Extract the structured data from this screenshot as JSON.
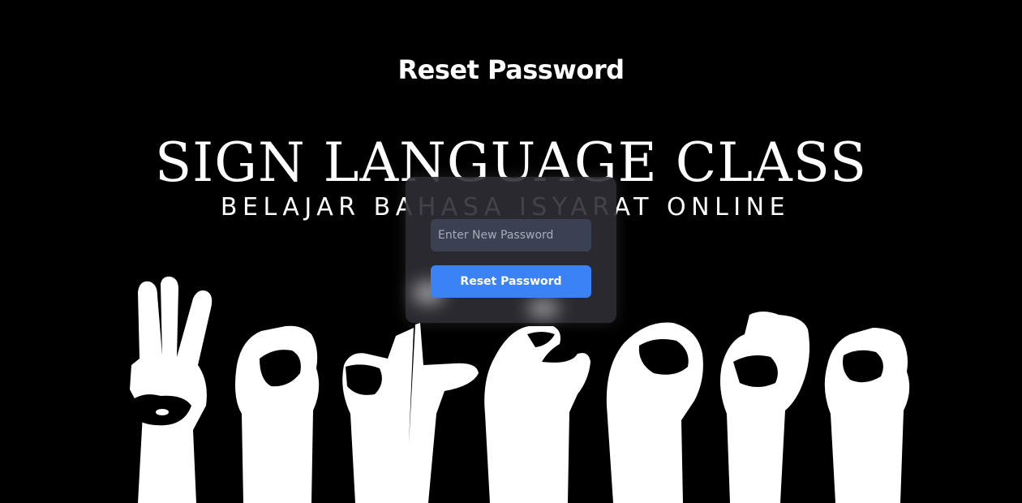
{
  "page": {
    "title": "Reset Password"
  },
  "hero": {
    "title": "SIGN LANGUAGE CLASS",
    "subtitle": "BELAJAR BAHASA ISYARAT ONLINE",
    "icon": "sign-language-hands-illustration"
  },
  "form": {
    "password_placeholder": "Enter New Password",
    "password_value": "",
    "submit_label": "Reset Password"
  },
  "colors": {
    "background": "#000000",
    "accent": "#3b82f6",
    "input_background": "#3a4152"
  }
}
